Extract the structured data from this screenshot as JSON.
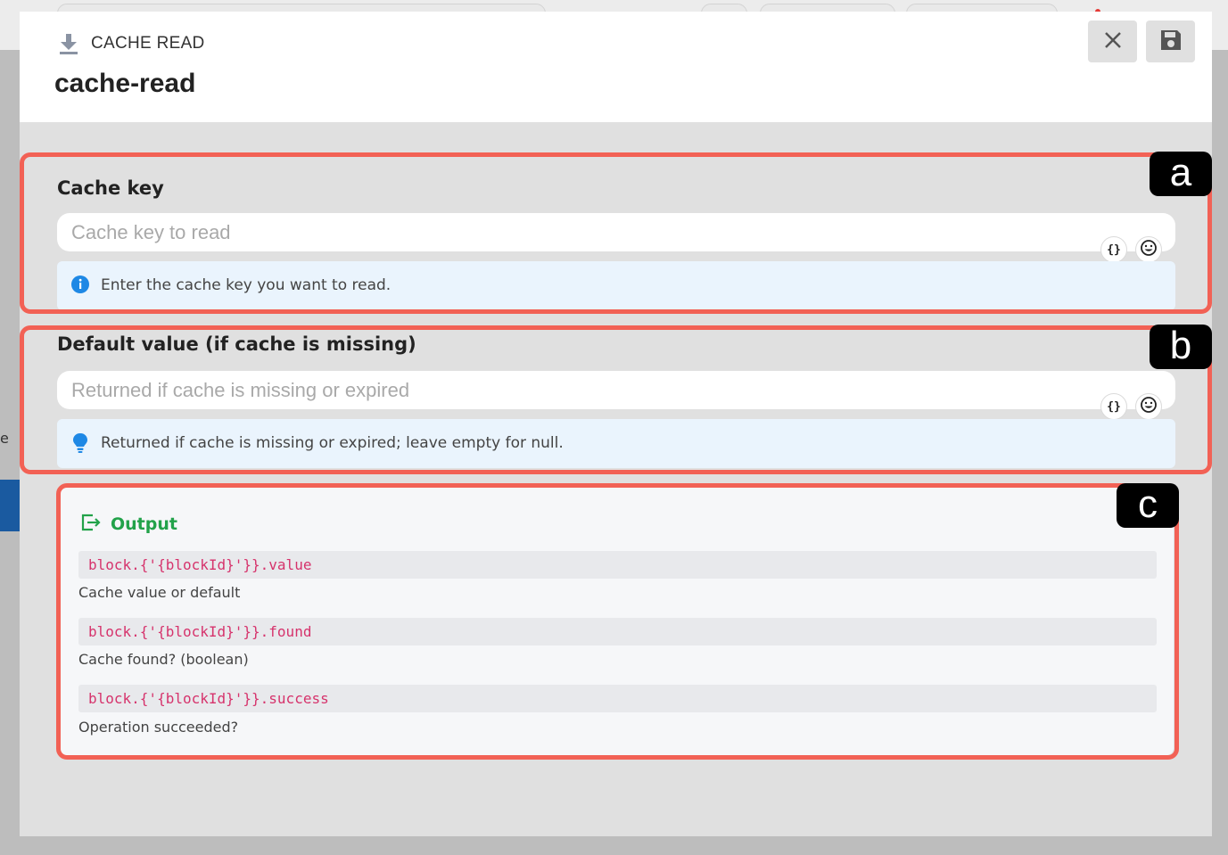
{
  "header": {
    "block_type": "CACHE READ",
    "block_name": "cache-read",
    "icons": {
      "type": "download-icon",
      "close": "close-icon",
      "save": "save-icon"
    }
  },
  "fields": {
    "cache_key": {
      "label": "Cache key",
      "placeholder": "Cache key to read",
      "value": "",
      "variable_button": "{}",
      "hint": "Enter the cache key you want to read.",
      "hint_icon": "info-icon"
    },
    "default_value": {
      "label": "Default value (if cache is missing)",
      "placeholder": "Returned if cache is missing or expired",
      "value": "",
      "variable_button": "{}",
      "hint": "Returned if cache is missing or expired; leave empty for null.",
      "hint_icon": "lightbulb-icon"
    }
  },
  "output": {
    "title": "Output",
    "icon": "output-icon",
    "items": [
      {
        "code": "block.{'{blockId}'}}.value",
        "description": "Cache value or default"
      },
      {
        "code": "block.{'{blockId}'}}.found",
        "description": "Cache found? (boolean)"
      },
      {
        "code": "block.{'{blockId}'}}.success",
        "description": "Operation succeeded?"
      }
    ]
  },
  "annotations": [
    "a",
    "b",
    "c"
  ],
  "colors": {
    "annotation_border": "#f26155",
    "output_green": "#22a24a",
    "code_pink": "#d6336c",
    "hint_blue_bg": "#eaf4fd",
    "info_blue": "#1e88e5"
  }
}
